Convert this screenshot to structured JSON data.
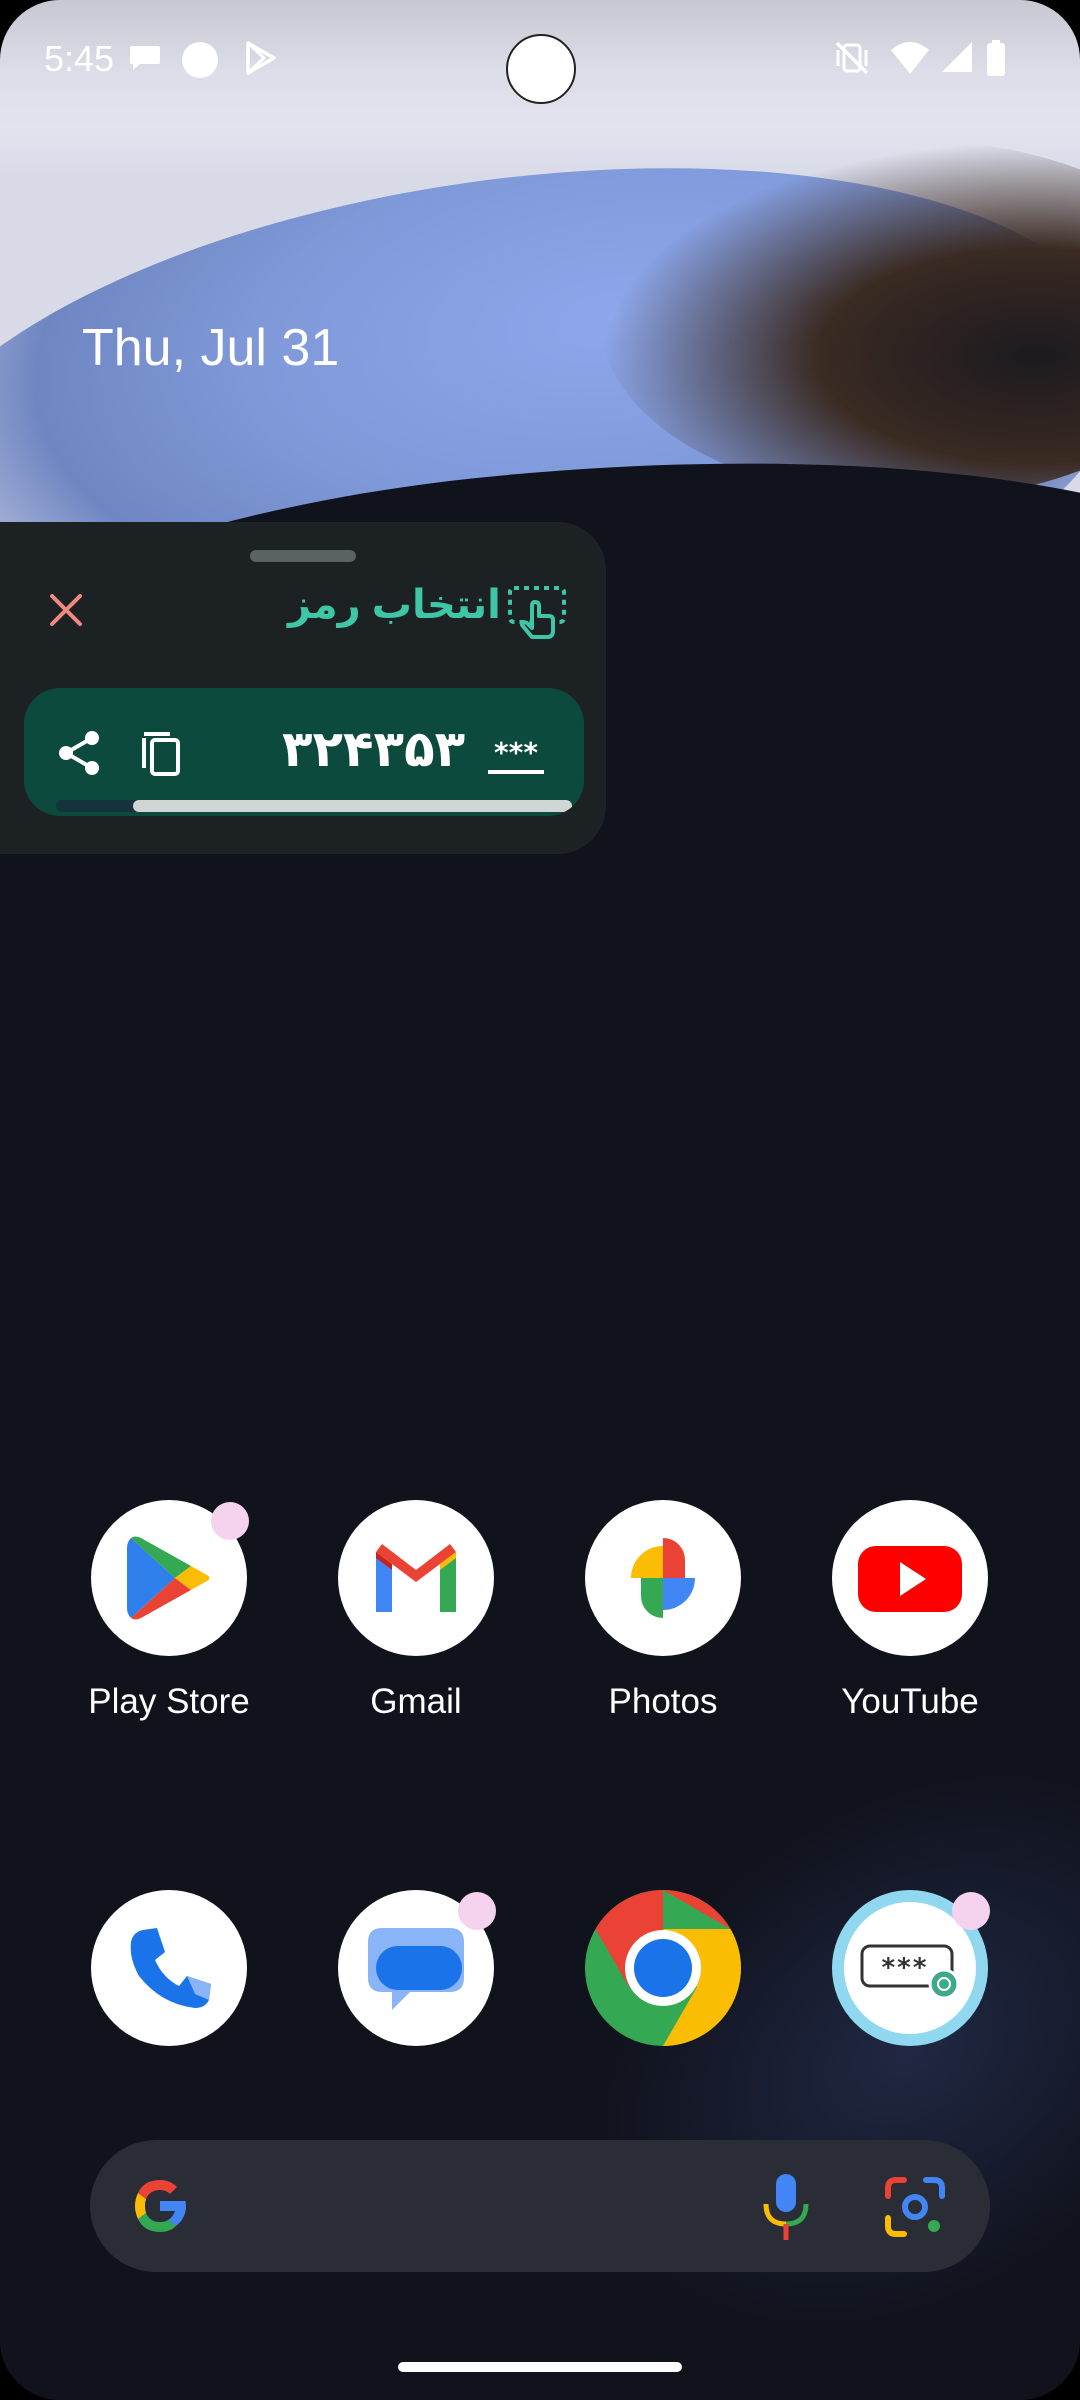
{
  "status_bar": {
    "time": "5:45",
    "left_icons": [
      "chat-bubble-icon",
      "circle-notification-icon",
      "play-triangle-icon"
    ],
    "right_icons": [
      "vibrate-off-icon",
      "wifi-icon",
      "cell-signal-icon",
      "battery-icon"
    ]
  },
  "lockscreen": {
    "date": "Thu, Jul 31"
  },
  "panel": {
    "title": "انتخاب رمز",
    "code": "۳۲۴۳۵۳",
    "accent_color": "#3fc6a6",
    "close_color": "#f08a80",
    "timer_progress_percent": 85
  },
  "dock_row1": [
    {
      "label": "Play Store",
      "icon": "play-store-icon",
      "badge": true
    },
    {
      "label": "Gmail",
      "icon": "gmail-icon",
      "badge": false
    },
    {
      "label": "Photos",
      "icon": "photos-icon",
      "badge": false
    },
    {
      "label": "YouTube",
      "icon": "youtube-icon",
      "badge": false
    }
  ],
  "dock_row2": [
    {
      "icon": "phone-icon",
      "badge": false
    },
    {
      "icon": "messages-icon",
      "badge": true
    },
    {
      "icon": "chrome-icon",
      "badge": false
    },
    {
      "icon": "password-app-icon",
      "badge": true
    }
  ],
  "search": {
    "icons": [
      "google-g-icon",
      "microphone-icon",
      "lens-icon"
    ]
  }
}
